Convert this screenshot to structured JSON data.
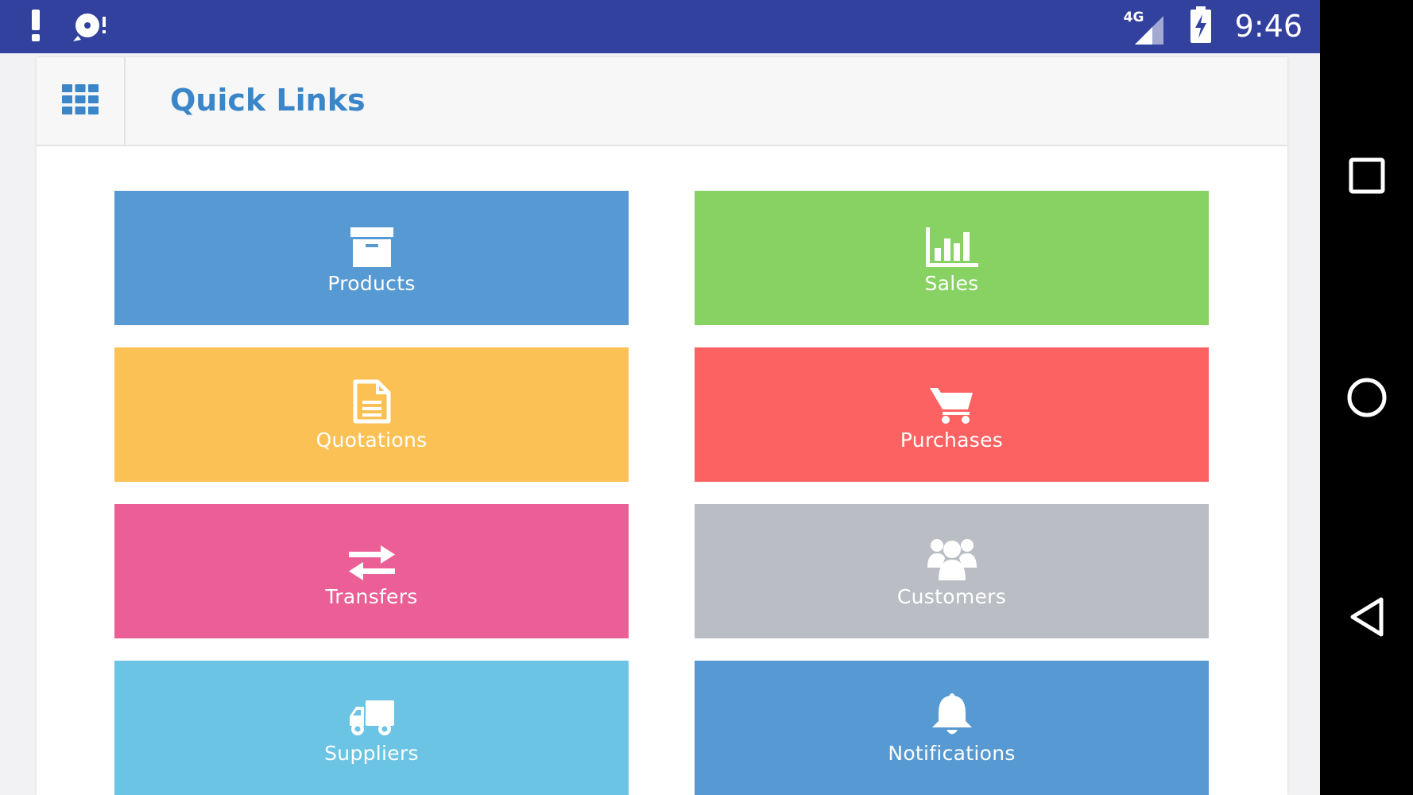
{
  "status_bar": {
    "time": "9:46",
    "network": "4G",
    "bg_color": "#32409e",
    "left_icons": [
      "alert-icon",
      "sync-icon"
    ],
    "right_icons": [
      "signal-icon",
      "battery-charging-icon"
    ]
  },
  "header": {
    "title": "Quick Links",
    "menu_icon": "grid-menu-icon",
    "title_color": "#3a86c8"
  },
  "tiles": [
    {
      "label": "Products",
      "icon": "archive-box-icon",
      "color": "#5799d2"
    },
    {
      "label": "Sales",
      "icon": "bar-chart-icon",
      "color": "#88d263"
    },
    {
      "label": "Quotations",
      "icon": "document-icon",
      "color": "#fbc155"
    },
    {
      "label": "Purchases",
      "icon": "shopping-cart-icon",
      "color": "#fd6263"
    },
    {
      "label": "Transfers",
      "icon": "exchange-arrows-icon",
      "color": "#eb5f96"
    },
    {
      "label": "Customers",
      "icon": "users-group-icon",
      "color": "#babec4"
    },
    {
      "label": "Suppliers",
      "icon": "truck-icon",
      "color": "#6cc4e4"
    },
    {
      "label": "Notifications",
      "icon": "bell-icon",
      "color": "#5799d2"
    }
  ],
  "nav_bar": {
    "buttons": [
      "recents-square-icon",
      "home-circle-icon",
      "back-triangle-icon"
    ]
  }
}
